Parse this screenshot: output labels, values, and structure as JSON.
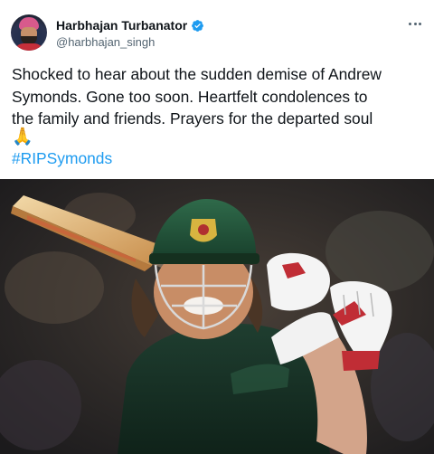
{
  "user": {
    "display_name": "Harbhajan Turbanator",
    "handle": "@harbhajan_singh",
    "verified": true
  },
  "tweet": {
    "text": "Shocked to hear about the sudden demise of Andrew\nSymonds. Gone too soon. Heartfelt condolences to\nthe family and friends. Prayers for the departed soul",
    "emoji": "🙏",
    "hashtag": "#RIPSymonds"
  },
  "icons": {
    "verified": "verified-badge-icon",
    "more": "more-options-icon"
  },
  "colors": {
    "link": "#1d9bf0",
    "verified": "#1d9bf0",
    "text": "#0f1419",
    "muted": "#536471"
  }
}
